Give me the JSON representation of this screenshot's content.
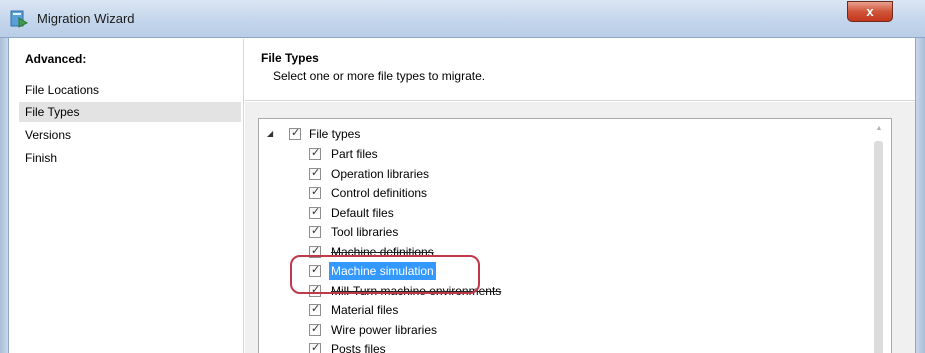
{
  "window": {
    "title": "Migration Wizard",
    "close_label": "x"
  },
  "nav": {
    "heading": "Advanced:",
    "items": [
      {
        "label": "File Locations",
        "selected": false
      },
      {
        "label": "File Types",
        "selected": true
      },
      {
        "label": "Versions",
        "selected": false
      },
      {
        "label": "Finish",
        "selected": false
      }
    ]
  },
  "content": {
    "title": "File Types",
    "subtitle": "Select one or more file types to migrate."
  },
  "tree": {
    "root": {
      "label": "File types",
      "checked": true,
      "expanded": true
    },
    "items": [
      {
        "label": "Part files",
        "checked": true
      },
      {
        "label": "Operation libraries",
        "checked": true
      },
      {
        "label": "Control definitions",
        "checked": true
      },
      {
        "label": "Default files",
        "checked": true
      },
      {
        "label": "Tool libraries",
        "checked": true
      },
      {
        "label": "Machine definitions",
        "checked": true
      },
      {
        "label": "Machine simulation",
        "checked": true,
        "selected": true
      },
      {
        "label": "Mill-Turn machine environments",
        "checked": true
      },
      {
        "label": "Material files",
        "checked": true
      },
      {
        "label": "Wire power libraries",
        "checked": true
      },
      {
        "label": "Posts files",
        "checked": true
      }
    ]
  },
  "colors": {
    "selection": "#3399ff",
    "annotation": "#c0394b",
    "close_button": "#c4371e"
  }
}
